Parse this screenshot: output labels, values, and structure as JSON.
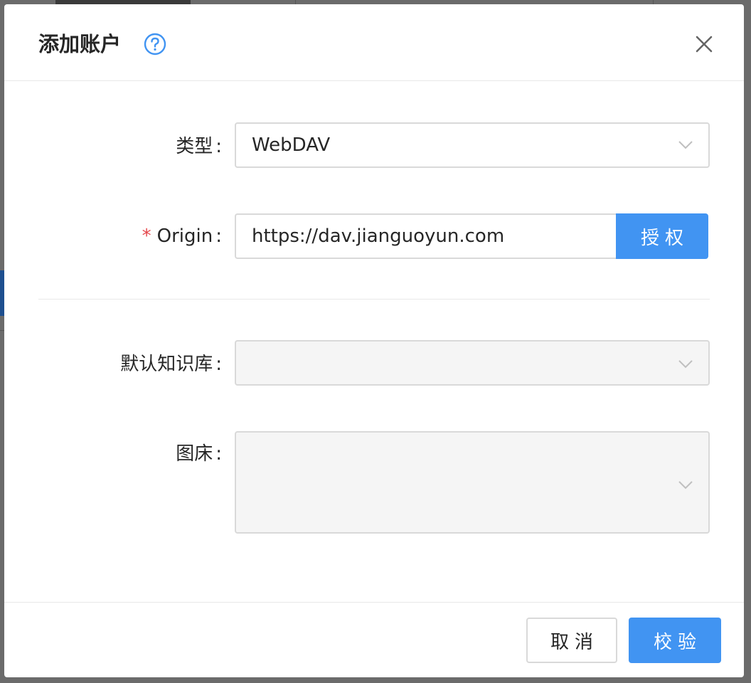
{
  "dialog": {
    "title": "添加账户",
    "help_icon": "question-circle-icon",
    "close_icon": "close-icon"
  },
  "form": {
    "type": {
      "label": "类型",
      "value": "WebDAV"
    },
    "origin": {
      "label": "Origin",
      "required_mark": "*",
      "value": "https://dav.jianguoyun.com",
      "auth_button": "授权"
    },
    "default_repo": {
      "label": "默认知识库",
      "value": ""
    },
    "image_host": {
      "label": "图床",
      "value": ""
    },
    "colon": ":"
  },
  "footer": {
    "cancel_label": "取消",
    "verify_label": "校验"
  },
  "colors": {
    "primary": "#4194f2",
    "required": "#e5484d",
    "border": "#d9d9d9",
    "disabled_bg": "#f5f5f5"
  }
}
